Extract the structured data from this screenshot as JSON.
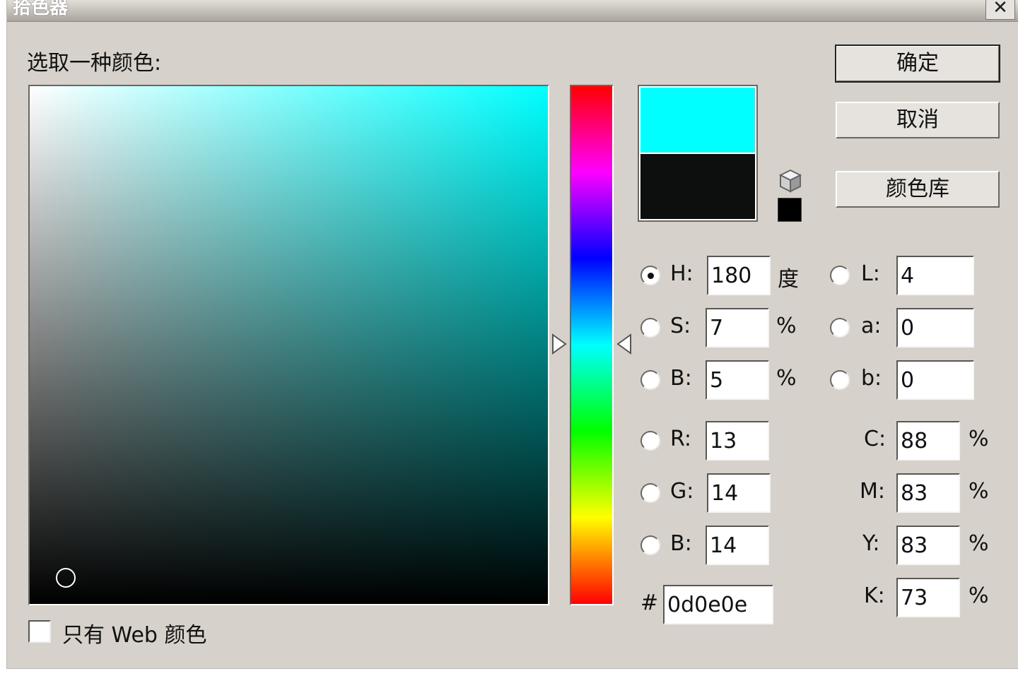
{
  "window": {
    "title": "拾色器",
    "close_glyph": "✕"
  },
  "heading": "选取一种颜色:",
  "colors": {
    "hue_color": "#00ffff",
    "new_color": "#00ffff",
    "current_color": "#0d0e0e",
    "websafe_color": "#000000"
  },
  "picker": {
    "saturation_pct": 7,
    "brightness_pct": 5,
    "hue_deg": 180
  },
  "buttons": {
    "ok": "确定",
    "cancel": "取消",
    "libraries": "颜色库"
  },
  "hsb": [
    {
      "id": "h",
      "label": "H:",
      "value": "180",
      "unit": "度",
      "checked": true
    },
    {
      "id": "s",
      "label": "S:",
      "value": "7",
      "unit": "%",
      "checked": false
    },
    {
      "id": "b",
      "label": "B:",
      "value": "5",
      "unit": "%",
      "checked": false
    }
  ],
  "lab": [
    {
      "id": "l",
      "label": "L:",
      "value": "4"
    },
    {
      "id": "a",
      "label": "a:",
      "value": "0"
    },
    {
      "id": "b",
      "label": "b:",
      "value": "0"
    }
  ],
  "rgb": [
    {
      "id": "r",
      "label": "R:",
      "value": "13"
    },
    {
      "id": "g",
      "label": "G:",
      "value": "14"
    },
    {
      "id": "b",
      "label": "B:",
      "value": "14"
    }
  ],
  "cmyk": [
    {
      "id": "c",
      "label": "C:",
      "value": "88",
      "unit": "%"
    },
    {
      "id": "m",
      "label": "M:",
      "value": "83",
      "unit": "%"
    },
    {
      "id": "y",
      "label": "Y:",
      "value": "83",
      "unit": "%"
    },
    {
      "id": "k",
      "label": "K:",
      "value": "73",
      "unit": "%"
    }
  ],
  "hex": {
    "label": "#",
    "value": "0d0e0e"
  },
  "web_only": {
    "label": "只有 Web 颜色",
    "checked": false
  }
}
